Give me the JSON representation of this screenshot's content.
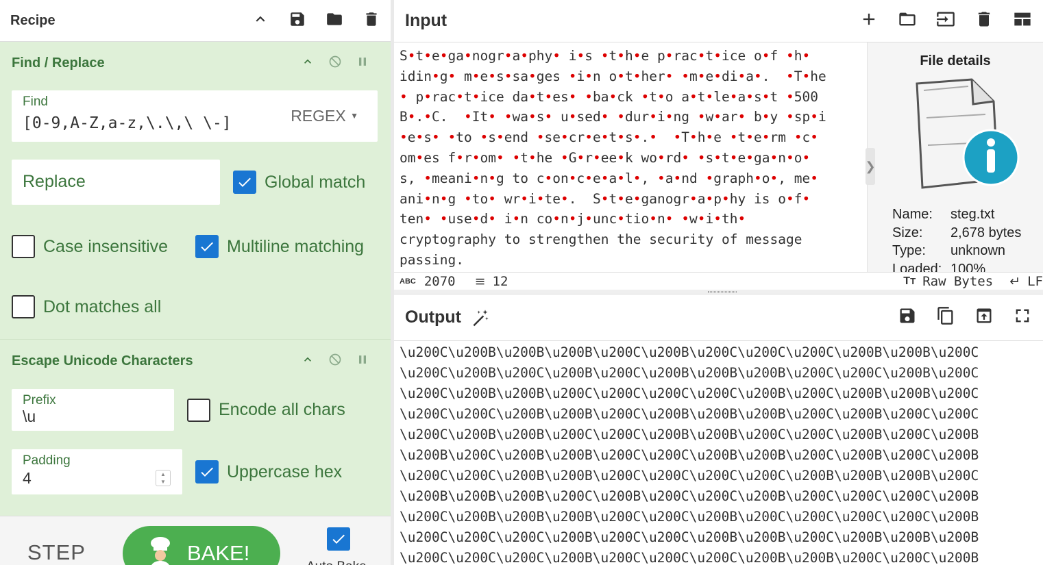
{
  "recipe": {
    "title": "Recipe",
    "ops": [
      {
        "title": "Find / Replace",
        "find_label": "Find",
        "find_value": "[0-9,A-Z,a-z,\\.\\,\\ \\-]",
        "find_mode": "REGEX",
        "replace_placeholder": "Replace",
        "global_match": "Global match",
        "case_insensitive": "Case insensitive",
        "multiline": "Multiline matching",
        "dot_all": "Dot matches all"
      },
      {
        "title": "Escape Unicode Characters",
        "prefix_label": "Prefix",
        "prefix_value": "\\u",
        "encode_all": "Encode all chars",
        "padding_label": "Padding",
        "padding_value": "4",
        "uppercase_hex": "Uppercase hex"
      }
    ],
    "step_label": "STEP",
    "bake_label": "BAKE!",
    "auto_bake_label": "Auto Bake"
  },
  "input": {
    "title": "Input",
    "lines": [
      "S•t•e•ga•nogr•a•phy• i•s •t•h•e p•rac•t•ice o•f •h•",
      "idin•g• m•e•s•sa•ges •i•n o•t•her• •m•e•di•a•.  •T•he",
      "• p•rac•t•ice da•t•es• •ba•ck •t•o a•t•le•a•s•t •500",
      "B•.•C.  •It• •wa•s• u•sed• •dur•i•ng •w•ar• b•y •sp•i",
      "•e•s• •to •s•end •se•cr•e•t•s•.•  •T•h•e •t•e•rm •c•",
      "om•es f•r•om• •t•he •G•r•ee•k wo•rd• •s•t•e•ga•n•o•",
      "s, •meani•n•g to c•on•c•e•a•l•, •a•nd •graph•o•, me•",
      "ani•n•g •to• wr•i•te•.  S•t•e•ganogr•a•p•hy is o•f•",
      "ten• •use•d• i•n co•n•j•unc•tio•n• •w•i•th•",
      "cryptography to strengthen the security of message",
      "passing."
    ],
    "status": {
      "length_icon": "ABC",
      "length": "2070",
      "lines_count": "12",
      "encoding": "Raw Bytes",
      "eol": "LF"
    },
    "file": {
      "title": "File details",
      "name_k": "Name:",
      "name_v": "steg.txt",
      "size_k": "Size:",
      "size_v": "2,678 bytes",
      "type_k": "Type:",
      "type_v": "unknown",
      "loaded_k": "Loaded:",
      "loaded_v": "100%"
    }
  },
  "output": {
    "title": "Output",
    "lines": [
      "\\u200C\\u200B\\u200B\\u200B\\u200C\\u200B\\u200C\\u200C\\u200C\\u200B\\u200B\\u200C",
      "\\u200C\\u200B\\u200C\\u200B\\u200C\\u200B\\u200B\\u200B\\u200C\\u200C\\u200B\\u200C",
      "\\u200C\\u200B\\u200B\\u200C\\u200C\\u200C\\u200C\\u200B\\u200C\\u200B\\u200B\\u200C",
      "\\u200C\\u200C\\u200B\\u200B\\u200C\\u200B\\u200B\\u200B\\u200C\\u200B\\u200C\\u200C",
      "\\u200C\\u200B\\u200B\\u200C\\u200C\\u200B\\u200B\\u200C\\u200C\\u200B\\u200C\\u200B",
      "\\u200B\\u200C\\u200B\\u200B\\u200C\\u200C\\u200B\\u200B\\u200C\\u200B\\u200C\\u200B",
      "\\u200C\\u200C\\u200B\\u200B\\u200C\\u200C\\u200C\\u200C\\u200B\\u200B\\u200B\\u200C",
      "\\u200B\\u200B\\u200B\\u200C\\u200B\\u200C\\u200C\\u200B\\u200C\\u200C\\u200C\\u200B",
      "\\u200C\\u200B\\u200B\\u200B\\u200C\\u200C\\u200B\\u200C\\u200C\\u200C\\u200C\\u200B",
      "\\u200C\\u200C\\u200C\\u200B\\u200C\\u200C\\u200B\\u200B\\u200C\\u200B\\u200B\\u200B",
      "\\u200C\\u200C\\u200C\\u200B\\u200C\\u200C\\u200C\\u200B\\u200B\\u200C\\u200C\\u200B"
    ]
  },
  "colors": {
    "recipe_bg": "#dff0d8",
    "recipe_text": "#3c763d",
    "checkbox_on": "#1976d2",
    "bake_green": "#4caf50",
    "dot_red": "#dd0000"
  }
}
